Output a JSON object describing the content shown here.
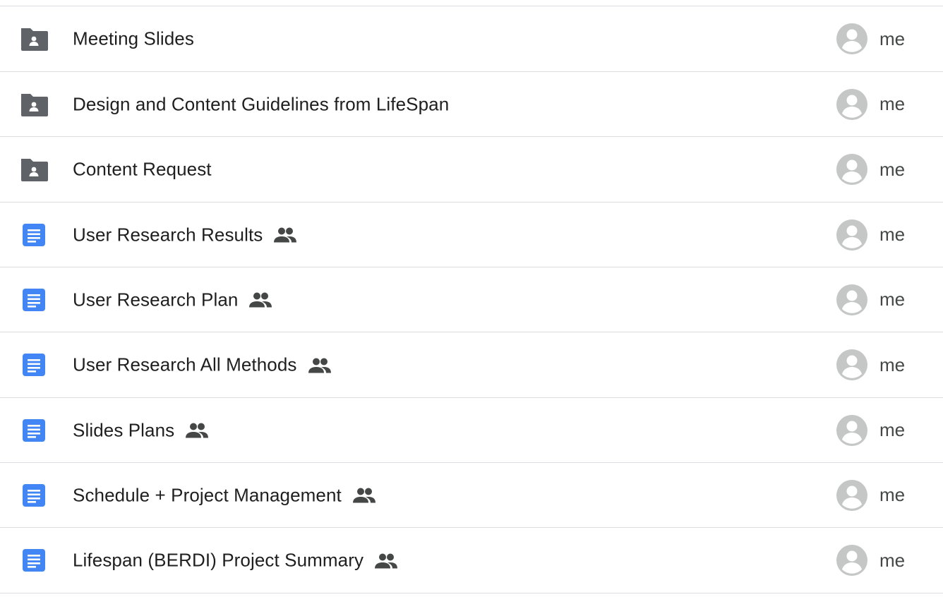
{
  "files": [
    {
      "name": "Meeting Slides",
      "type": "shared-folder",
      "type_icon": "shared-folder-icon",
      "shared": false,
      "owner": "me"
    },
    {
      "name": "Design and Content Guidelines from LifeSpan",
      "type": "shared-folder",
      "type_icon": "shared-folder-icon",
      "shared": false,
      "owner": "me"
    },
    {
      "name": "Content Request",
      "type": "shared-folder",
      "type_icon": "shared-folder-icon",
      "shared": false,
      "owner": "me"
    },
    {
      "name": "User Research Results",
      "type": "document",
      "type_icon": "google-docs-icon",
      "shared": true,
      "owner": "me"
    },
    {
      "name": "User Research Plan",
      "type": "document",
      "type_icon": "google-docs-icon",
      "shared": true,
      "owner": "me"
    },
    {
      "name": "User Research All Methods",
      "type": "document",
      "type_icon": "google-docs-icon",
      "shared": true,
      "owner": "me"
    },
    {
      "name": "Slides Plans",
      "type": "document",
      "type_icon": "google-docs-icon",
      "shared": true,
      "owner": "me"
    },
    {
      "name": "Schedule + Project Management",
      "type": "document",
      "type_icon": "google-docs-icon",
      "shared": true,
      "owner": "me"
    },
    {
      "name": "Lifespan (BERDI) Project Summary",
      "type": "document",
      "type_icon": "google-docs-icon",
      "shared": true,
      "owner": "me"
    }
  ],
  "icons": {
    "shared": "people-icon",
    "owner_avatar": "default-avatar-icon"
  },
  "colors": {
    "folder": "#5f6368",
    "docs_blue": "#4285f4",
    "text": "#1f1f1f",
    "owner_text": "#444746",
    "avatar": "#c4c7c5",
    "divider": "#dadce0"
  }
}
